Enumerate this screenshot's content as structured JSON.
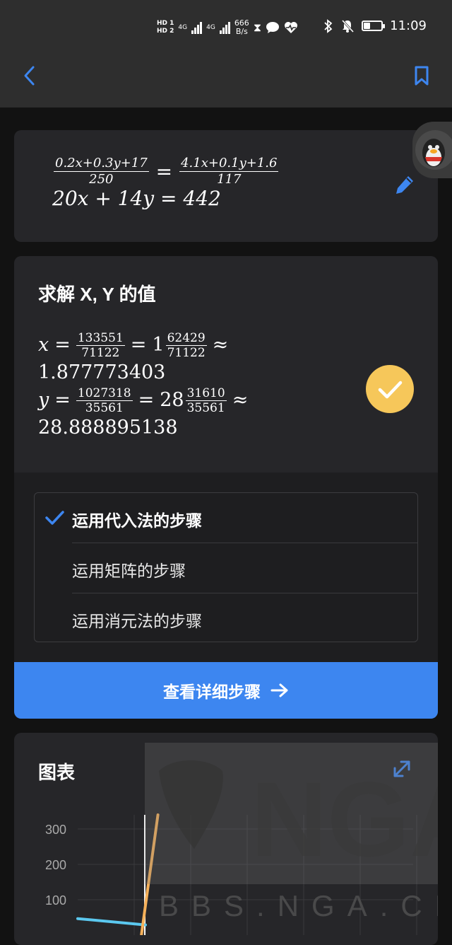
{
  "status_bar": {
    "hd1": "HD 1",
    "hd2": "HD 2",
    "net1": "4G",
    "net2": "4G",
    "speed_value": "666",
    "speed_unit": "B/s",
    "time": "11:09",
    "battery_level": 0.35
  },
  "equation": {
    "eq1_left_num": "0.2x+0.3y+17",
    "eq1_left_den": "250",
    "eq1_eq": "=",
    "eq1_right_num": "4.1x+0.1y+1.6",
    "eq1_right_den": "117",
    "eq2": "20x + 14y = 442"
  },
  "solution": {
    "title": "求解 X, Y 的值",
    "x": {
      "var": "x",
      "eq": "=",
      "num": "133551",
      "den": "71122",
      "whole": "1",
      "mixed_num": "62429",
      "mixed_den": "71122",
      "approx": "≈",
      "decimal": "1.877773403"
    },
    "y": {
      "var": "y",
      "eq": "=",
      "num": "1027318",
      "den": "35561",
      "whole": "28",
      "mixed_num": "31610",
      "mixed_den": "35561",
      "approx": "≈",
      "decimal": "28.888895138"
    }
  },
  "methods": [
    {
      "label": "运用代入法的步骤",
      "selected": true
    },
    {
      "label": "运用矩阵的步骤",
      "selected": false
    },
    {
      "label": "运用消元法的步骤",
      "selected": false
    }
  ],
  "detail_button": {
    "label": "查看详细步骤"
  },
  "chart_section": {
    "title": "图表"
  },
  "chart_data": {
    "type": "line",
    "y_ticks": [
      "300",
      "200",
      "100"
    ],
    "y_tick_values": [
      300,
      200,
      100
    ],
    "ylim": [
      0,
      340
    ],
    "xlim": [
      -10,
      50
    ],
    "vertical_marker_x": 1.88,
    "series": [
      {
        "color": "#5bc8ef",
        "points": [
          [
            -10,
            46.6
          ],
          [
            2,
            28.8
          ]
        ]
      },
      {
        "color": "#f6b15a",
        "points": [
          [
            1.1,
            -20
          ],
          [
            4.2,
            340
          ]
        ]
      }
    ],
    "grid": true
  },
  "watermark": {
    "brand": "NGA",
    "url": "BBS.NGA.CN"
  },
  "colors": {
    "accent": "#3d86f0",
    "check": "#f6c75a",
    "card": "#262629",
    "background": "#121212"
  }
}
